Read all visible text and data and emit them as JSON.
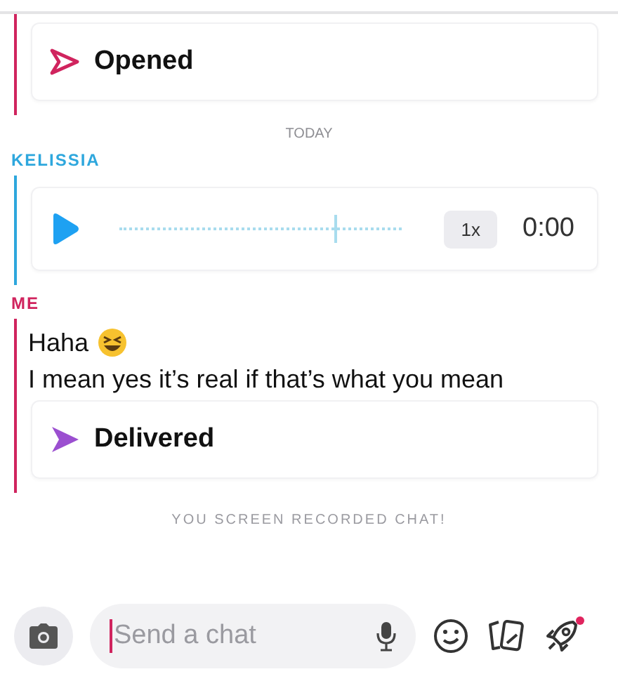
{
  "thread": [
    {
      "kind": "group",
      "color": "#d0245e",
      "items": [
        {
          "kind": "opened",
          "label": "Opened"
        }
      ]
    },
    {
      "kind": "divider",
      "label": "TODAY"
    },
    {
      "kind": "group",
      "sender": "KELISSIA",
      "color": "#2ea7dd",
      "items": [
        {
          "kind": "audio",
          "level": 0.76,
          "speed": "1x",
          "time": "0:00"
        }
      ]
    },
    {
      "kind": "group",
      "sender": "ME",
      "color": "#d0245e",
      "items": [
        {
          "kind": "text",
          "text": "Haha",
          "emoji": true
        },
        {
          "kind": "text",
          "text": "I mean yes it’s real if that’s what you mean",
          "emoji": false
        },
        {
          "kind": "delivered",
          "label": "Delivered"
        }
      ]
    },
    {
      "kind": "notice",
      "label": "YOU SCREEN RECORDED CHAT!"
    }
  ],
  "composer": {
    "placeholder": "Send a chat",
    "rocket_badge": true
  }
}
